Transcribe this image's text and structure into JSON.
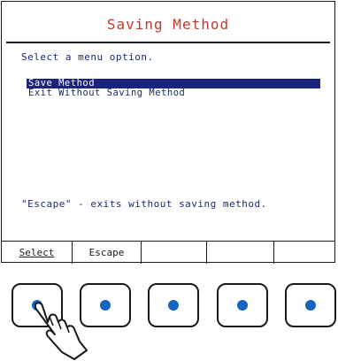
{
  "screen": {
    "title": "Saving Method",
    "prompt": "Select a menu option.",
    "menu_items": [
      {
        "label": "Save Method",
        "selected": true
      },
      {
        "label": "Exit Without Saving Method",
        "selected": false
      }
    ],
    "hint": "\"Escape\" - exits without saving method."
  },
  "softkeys": [
    {
      "label": "Select"
    },
    {
      "label": "Escape"
    },
    {
      "label": ""
    },
    {
      "label": ""
    },
    {
      "label": ""
    }
  ],
  "hardware_buttons": [
    "button-1",
    "button-2",
    "button-3",
    "button-4",
    "button-5"
  ],
  "colors": {
    "title": "#c0392b",
    "text": "#1a2a6c",
    "selection": "#1a237e",
    "button_dot": "#1565c0"
  },
  "icons": {
    "pointer": "pointing-hand-icon"
  }
}
